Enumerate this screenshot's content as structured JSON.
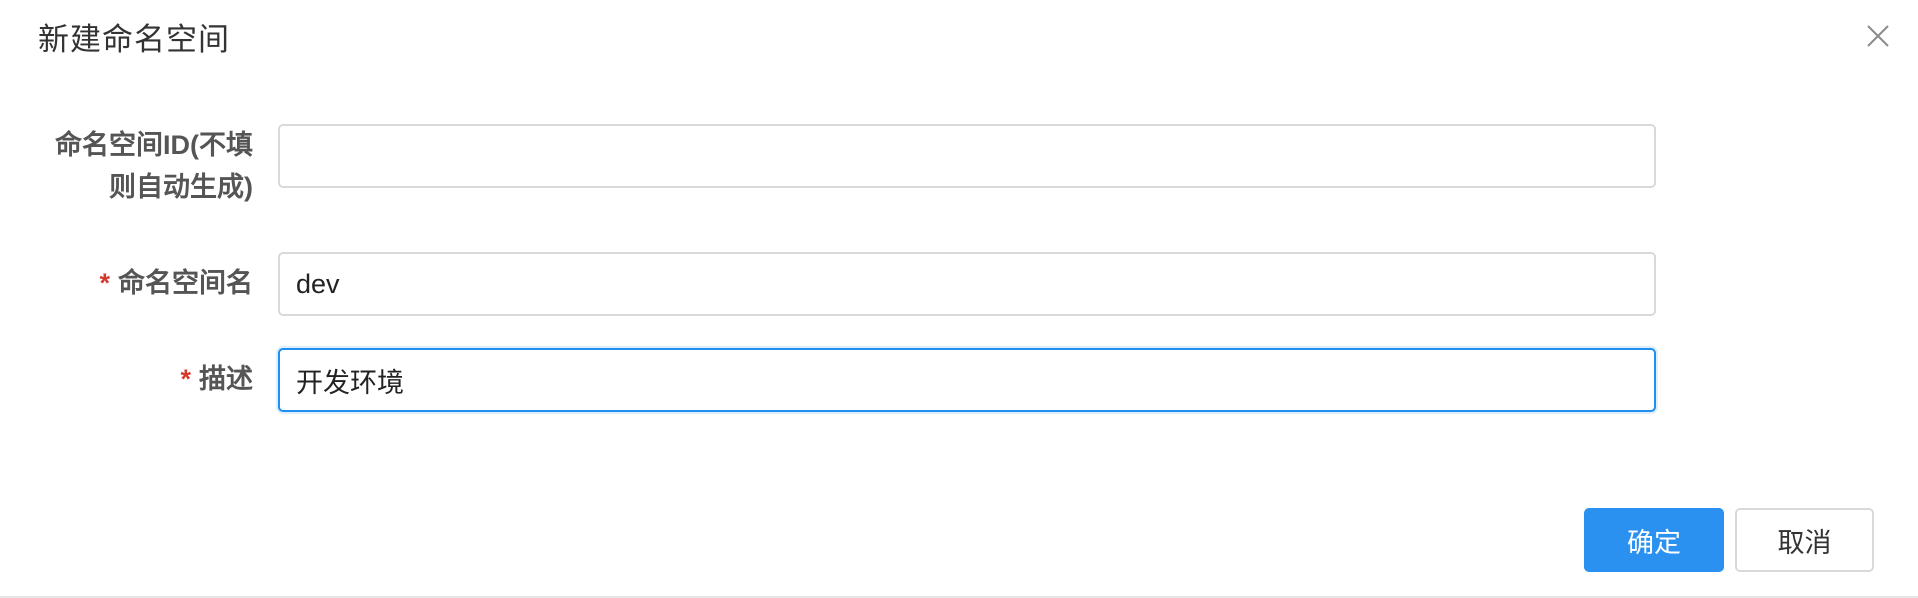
{
  "dialog": {
    "title": "新建命名空间",
    "close_icon": "close-icon"
  },
  "form": {
    "namespace_id": {
      "label_line1": "命名空间ID(不填",
      "label_line2": "则自动生成)",
      "value": "",
      "required": false
    },
    "namespace_name": {
      "required_mark": "*",
      "label": "命名空间名",
      "value": "dev",
      "required": true
    },
    "description": {
      "required_mark": "*",
      "label": "描述",
      "value": "开发环境",
      "required": true,
      "focused": true
    }
  },
  "footer": {
    "confirm_label": "确定",
    "cancel_label": "取消"
  },
  "colors": {
    "primary": "#2a91f0",
    "required": "#d33a2c",
    "focus_border": "#1f8ff0"
  }
}
